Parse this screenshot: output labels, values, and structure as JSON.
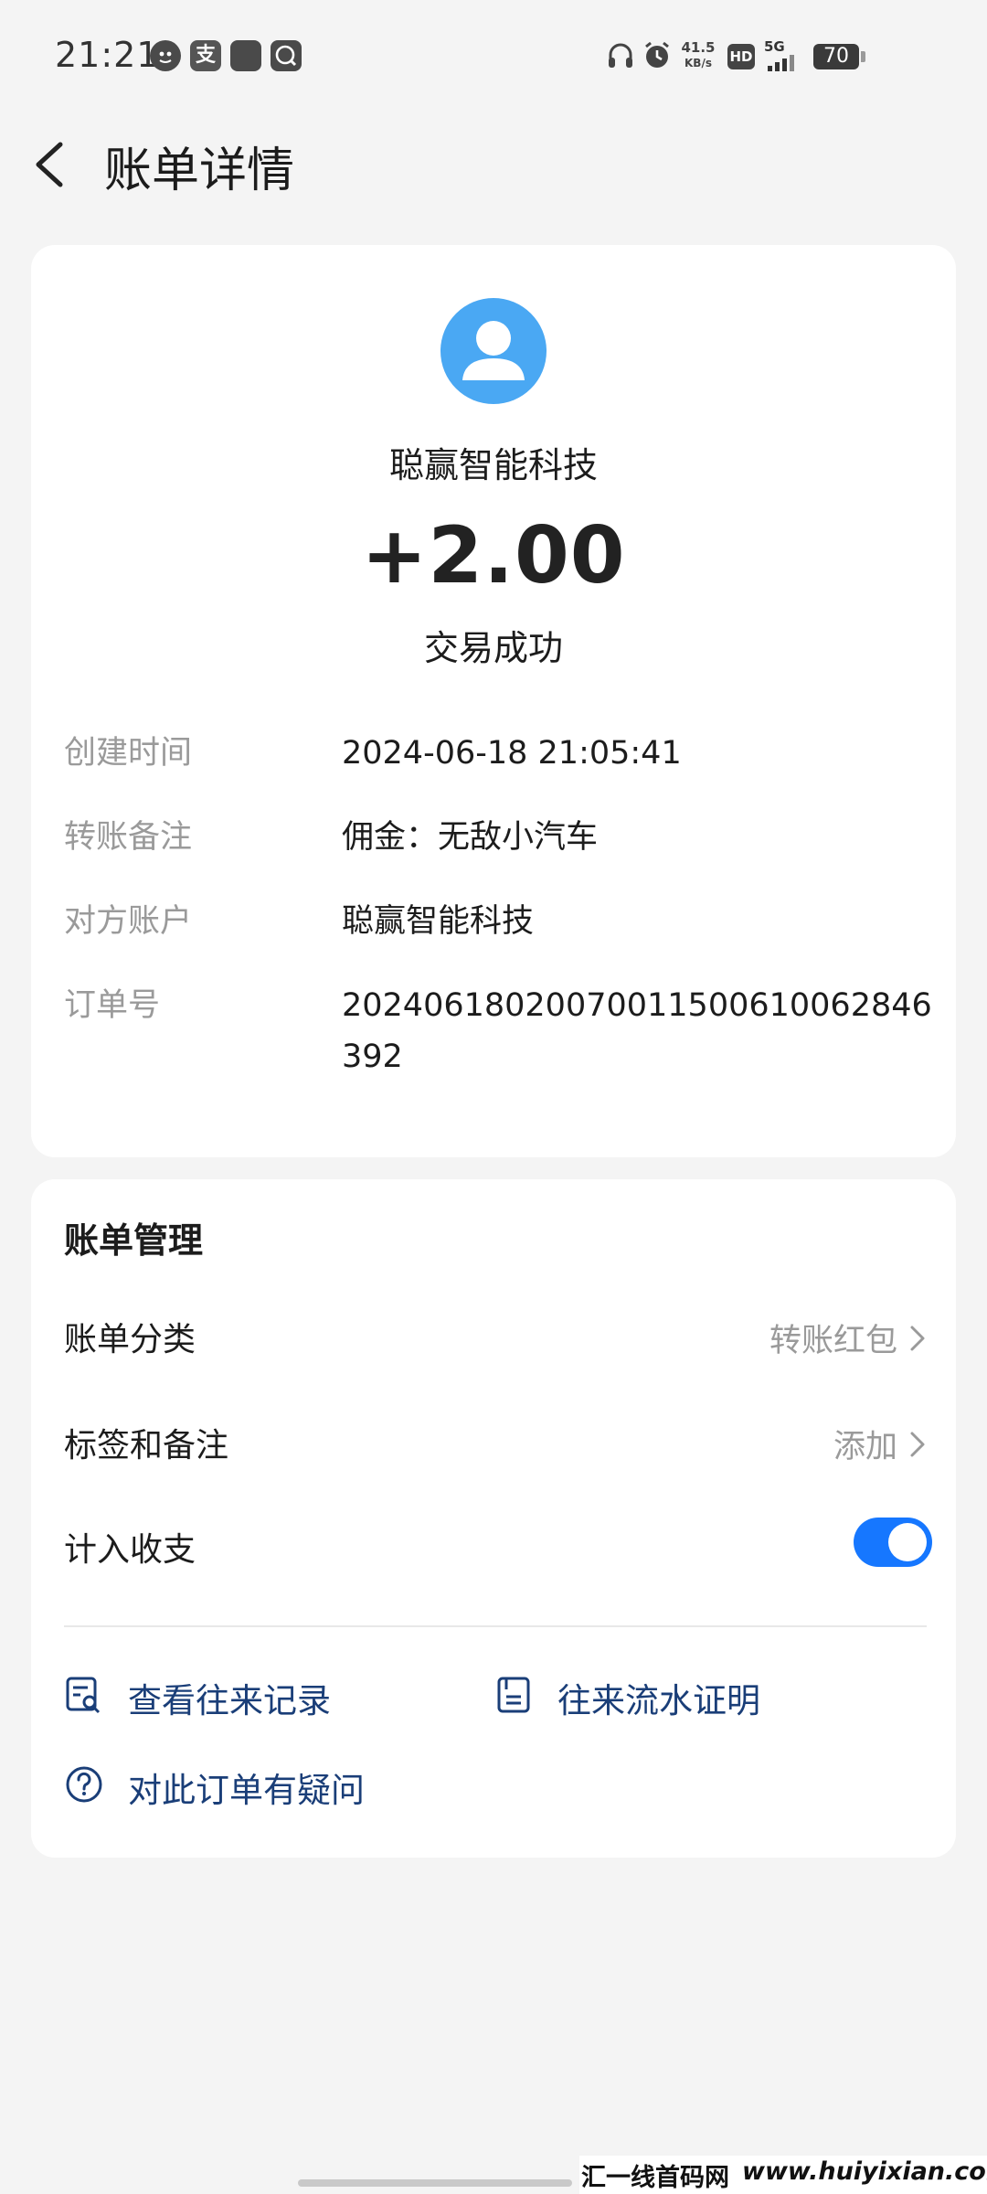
{
  "status_bar": {
    "time": "21:21",
    "app_icons": [
      "qq-icon",
      "alipay-icon",
      "app-icon",
      "browser-icon"
    ],
    "alipay_glyph": "支",
    "net_speed_value": "41.5",
    "net_speed_unit": "KB/s",
    "hd_label": "HD",
    "network_label": "5G",
    "battery": "70"
  },
  "header": {
    "title": "账单详情"
  },
  "transaction": {
    "counterparty": "聪赢智能科技",
    "amount": "+2.00",
    "status": "交易成功",
    "details": [
      {
        "label": "创建时间",
        "value": "2024-06-18 21:05:41"
      },
      {
        "label": "转账备注",
        "value": "佣金：无敌小汽车"
      },
      {
        "label": "对方账户",
        "value": "聪赢智能科技"
      },
      {
        "label": "订单号",
        "value": "20240618020070011500610062846392"
      }
    ]
  },
  "management": {
    "title": "账单管理",
    "category_label": "账单分类",
    "category_value": "转账红包",
    "tags_label": "标签和备注",
    "tags_value": "添加",
    "include_label": "计入收支",
    "include_enabled": true,
    "actions": {
      "records": "查看往来记录",
      "proof": "往来流水证明",
      "question": "对此订单有疑问"
    }
  },
  "watermark": {
    "left": "汇一线首码网",
    "right": "www.huiyixian.com"
  },
  "colors": {
    "accent": "#1677ff",
    "avatar": "#4aa8f3",
    "link": "#1a3e78",
    "muted": "#9a9a9a",
    "background": "#f4f4f4"
  }
}
